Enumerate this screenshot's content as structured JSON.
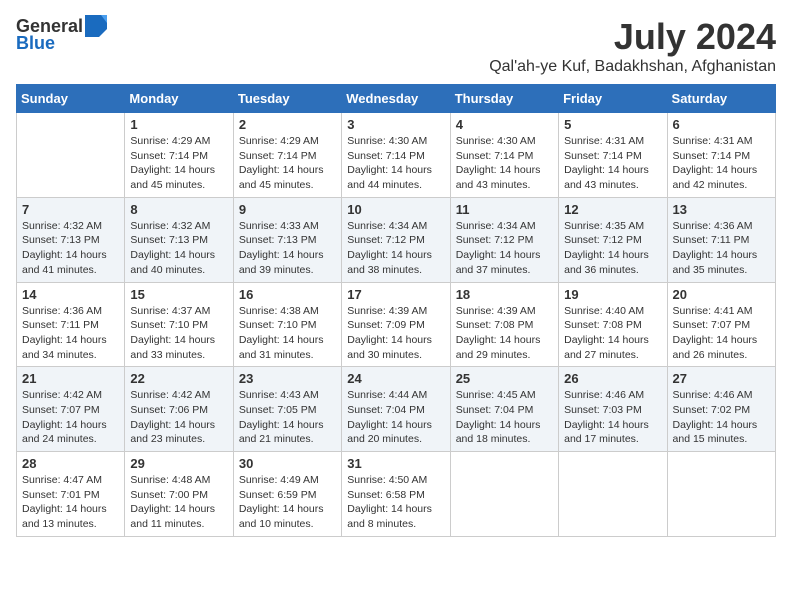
{
  "header": {
    "logo_general": "General",
    "logo_blue": "Blue",
    "main_title": "July 2024",
    "subtitle": "Qal'ah-ye Kuf, Badakhshan, Afghanistan"
  },
  "calendar": {
    "days_of_week": [
      "Sunday",
      "Monday",
      "Tuesday",
      "Wednesday",
      "Thursday",
      "Friday",
      "Saturday"
    ],
    "weeks": [
      [
        {
          "day": "",
          "sunrise": "",
          "sunset": "",
          "daylight": ""
        },
        {
          "day": "1",
          "sunrise": "Sunrise: 4:29 AM",
          "sunset": "Sunset: 7:14 PM",
          "daylight": "Daylight: 14 hours and 45 minutes."
        },
        {
          "day": "2",
          "sunrise": "Sunrise: 4:29 AM",
          "sunset": "Sunset: 7:14 PM",
          "daylight": "Daylight: 14 hours and 45 minutes."
        },
        {
          "day": "3",
          "sunrise": "Sunrise: 4:30 AM",
          "sunset": "Sunset: 7:14 PM",
          "daylight": "Daylight: 14 hours and 44 minutes."
        },
        {
          "day": "4",
          "sunrise": "Sunrise: 4:30 AM",
          "sunset": "Sunset: 7:14 PM",
          "daylight": "Daylight: 14 hours and 43 minutes."
        },
        {
          "day": "5",
          "sunrise": "Sunrise: 4:31 AM",
          "sunset": "Sunset: 7:14 PM",
          "daylight": "Daylight: 14 hours and 43 minutes."
        },
        {
          "day": "6",
          "sunrise": "Sunrise: 4:31 AM",
          "sunset": "Sunset: 7:14 PM",
          "daylight": "Daylight: 14 hours and 42 minutes."
        }
      ],
      [
        {
          "day": "7",
          "sunrise": "Sunrise: 4:32 AM",
          "sunset": "Sunset: 7:13 PM",
          "daylight": "Daylight: 14 hours and 41 minutes."
        },
        {
          "day": "8",
          "sunrise": "Sunrise: 4:32 AM",
          "sunset": "Sunset: 7:13 PM",
          "daylight": "Daylight: 14 hours and 40 minutes."
        },
        {
          "day": "9",
          "sunrise": "Sunrise: 4:33 AM",
          "sunset": "Sunset: 7:13 PM",
          "daylight": "Daylight: 14 hours and 39 minutes."
        },
        {
          "day": "10",
          "sunrise": "Sunrise: 4:34 AM",
          "sunset": "Sunset: 7:12 PM",
          "daylight": "Daylight: 14 hours and 38 minutes."
        },
        {
          "day": "11",
          "sunrise": "Sunrise: 4:34 AM",
          "sunset": "Sunset: 7:12 PM",
          "daylight": "Daylight: 14 hours and 37 minutes."
        },
        {
          "day": "12",
          "sunrise": "Sunrise: 4:35 AM",
          "sunset": "Sunset: 7:12 PM",
          "daylight": "Daylight: 14 hours and 36 minutes."
        },
        {
          "day": "13",
          "sunrise": "Sunrise: 4:36 AM",
          "sunset": "Sunset: 7:11 PM",
          "daylight": "Daylight: 14 hours and 35 minutes."
        }
      ],
      [
        {
          "day": "14",
          "sunrise": "Sunrise: 4:36 AM",
          "sunset": "Sunset: 7:11 PM",
          "daylight": "Daylight: 14 hours and 34 minutes."
        },
        {
          "day": "15",
          "sunrise": "Sunrise: 4:37 AM",
          "sunset": "Sunset: 7:10 PM",
          "daylight": "Daylight: 14 hours and 33 minutes."
        },
        {
          "day": "16",
          "sunrise": "Sunrise: 4:38 AM",
          "sunset": "Sunset: 7:10 PM",
          "daylight": "Daylight: 14 hours and 31 minutes."
        },
        {
          "day": "17",
          "sunrise": "Sunrise: 4:39 AM",
          "sunset": "Sunset: 7:09 PM",
          "daylight": "Daylight: 14 hours and 30 minutes."
        },
        {
          "day": "18",
          "sunrise": "Sunrise: 4:39 AM",
          "sunset": "Sunset: 7:08 PM",
          "daylight": "Daylight: 14 hours and 29 minutes."
        },
        {
          "day": "19",
          "sunrise": "Sunrise: 4:40 AM",
          "sunset": "Sunset: 7:08 PM",
          "daylight": "Daylight: 14 hours and 27 minutes."
        },
        {
          "day": "20",
          "sunrise": "Sunrise: 4:41 AM",
          "sunset": "Sunset: 7:07 PM",
          "daylight": "Daylight: 14 hours and 26 minutes."
        }
      ],
      [
        {
          "day": "21",
          "sunrise": "Sunrise: 4:42 AM",
          "sunset": "Sunset: 7:07 PM",
          "daylight": "Daylight: 14 hours and 24 minutes."
        },
        {
          "day": "22",
          "sunrise": "Sunrise: 4:42 AM",
          "sunset": "Sunset: 7:06 PM",
          "daylight": "Daylight: 14 hours and 23 minutes."
        },
        {
          "day": "23",
          "sunrise": "Sunrise: 4:43 AM",
          "sunset": "Sunset: 7:05 PM",
          "daylight": "Daylight: 14 hours and 21 minutes."
        },
        {
          "day": "24",
          "sunrise": "Sunrise: 4:44 AM",
          "sunset": "Sunset: 7:04 PM",
          "daylight": "Daylight: 14 hours and 20 minutes."
        },
        {
          "day": "25",
          "sunrise": "Sunrise: 4:45 AM",
          "sunset": "Sunset: 7:04 PM",
          "daylight": "Daylight: 14 hours and 18 minutes."
        },
        {
          "day": "26",
          "sunrise": "Sunrise: 4:46 AM",
          "sunset": "Sunset: 7:03 PM",
          "daylight": "Daylight: 14 hours and 17 minutes."
        },
        {
          "day": "27",
          "sunrise": "Sunrise: 4:46 AM",
          "sunset": "Sunset: 7:02 PM",
          "daylight": "Daylight: 14 hours and 15 minutes."
        }
      ],
      [
        {
          "day": "28",
          "sunrise": "Sunrise: 4:47 AM",
          "sunset": "Sunset: 7:01 PM",
          "daylight": "Daylight: 14 hours and 13 minutes."
        },
        {
          "day": "29",
          "sunrise": "Sunrise: 4:48 AM",
          "sunset": "Sunset: 7:00 PM",
          "daylight": "Daylight: 14 hours and 11 minutes."
        },
        {
          "day": "30",
          "sunrise": "Sunrise: 4:49 AM",
          "sunset": "Sunset: 6:59 PM",
          "daylight": "Daylight: 14 hours and 10 minutes."
        },
        {
          "day": "31",
          "sunrise": "Sunrise: 4:50 AM",
          "sunset": "Sunset: 6:58 PM",
          "daylight": "Daylight: 14 hours and 8 minutes."
        },
        {
          "day": "",
          "sunrise": "",
          "sunset": "",
          "daylight": ""
        },
        {
          "day": "",
          "sunrise": "",
          "sunset": "",
          "daylight": ""
        },
        {
          "day": "",
          "sunrise": "",
          "sunset": "",
          "daylight": ""
        }
      ]
    ]
  }
}
